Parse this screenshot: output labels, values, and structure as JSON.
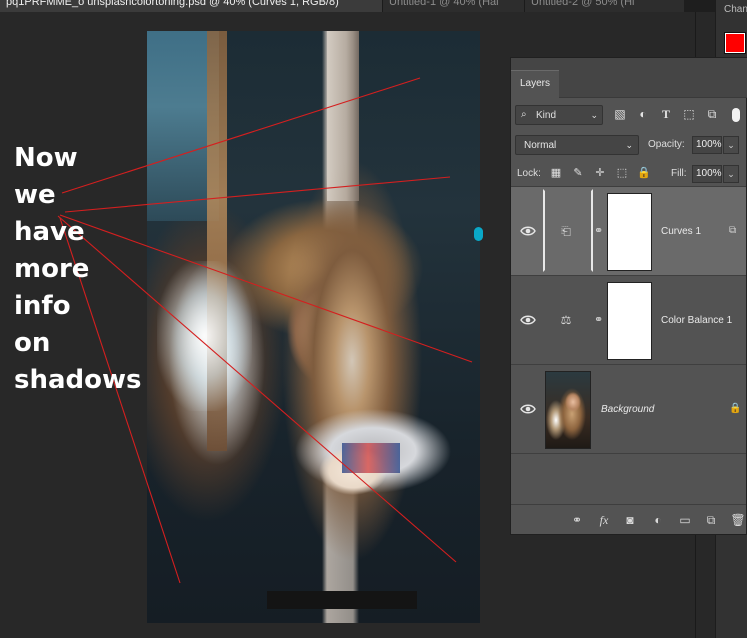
{
  "document_tabs": [
    {
      "label": "pq1PRFMME_o unsplashcolortoning.psd @ 40% (Curves 1, RGB/8)"
    },
    {
      "label": "Untitled-1 @ 40% (Hal"
    },
    {
      "label": "Untitled-2 @ 50% (Hi"
    }
  ],
  "right_rail": {
    "title": "Chan",
    "foreground_color": "#ff0000",
    "arrow": "‹"
  },
  "annotation": {
    "lines": [
      "Now",
      "we",
      "have",
      "more",
      "info",
      "on",
      "shadows"
    ],
    "line_color": "#d41f1f",
    "text_color": "#ffffff"
  },
  "layers_panel": {
    "tab_label": "Layers",
    "kind": {
      "icon": "⌕",
      "label": "Kind",
      "caret": "⌄"
    },
    "filter_icons": [
      "image-filter-icon",
      "adjustment-filter-icon",
      "type-filter-icon",
      "shape-filter-icon",
      "smart-object-filter-icon"
    ],
    "filter_glyphs": [
      "▧",
      "◐",
      "T",
      "⬚",
      "⧉"
    ],
    "blend_mode": "Normal",
    "blend_caret": "⌄",
    "opacity_label": "Opacity:",
    "opacity_value": "100%",
    "lock_label": "Lock:",
    "lock_glyphs": [
      "▦",
      "✎",
      "✛",
      "⬚",
      "🔒"
    ],
    "fill_label": "Fill:",
    "fill_value": "100%",
    "field_caret": "⌄",
    "layers": [
      {
        "name": "Curves 1",
        "adj_glyph": "⎗",
        "chain_glyph": "⚭",
        "clip_glyph": "⧉",
        "selected": true
      },
      {
        "name": "Color Balance 1",
        "adj_glyph": "⚖",
        "chain_glyph": "⚭",
        "selected": false
      },
      {
        "name": "Background",
        "lock_glyph": "🔒",
        "selected": false
      }
    ],
    "footer_glyphs": [
      "⚭",
      "fx",
      "◙",
      "◐",
      "▭",
      "⧉",
      "🗑"
    ]
  }
}
